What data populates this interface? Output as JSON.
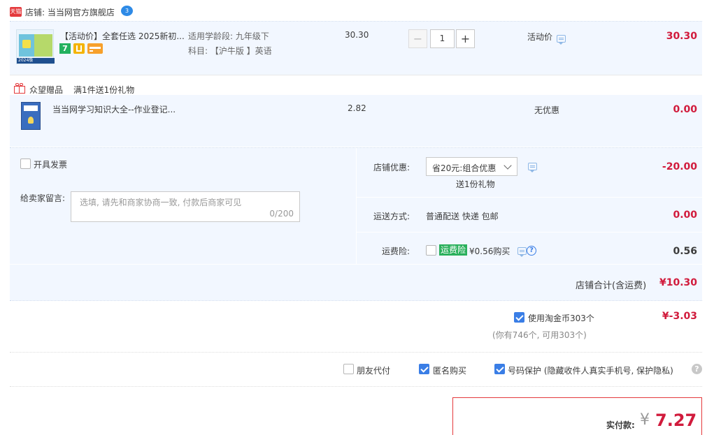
{
  "shop": {
    "badge": "天猫",
    "label": "店铺: 当当网官方旗舰店",
    "chat_badge": "3"
  },
  "item1": {
    "title": "【活动价】全套任选 2025新初...",
    "age": "适用学龄段: 九年级下",
    "subject": "科目: 【沪牛版 】英语",
    "thumb_caption": "2024版",
    "badge_seven": "7",
    "price": "30.30",
    "qty": "1",
    "minus": "−",
    "plus": "+",
    "promo": "活动价",
    "subtotal": "30.30"
  },
  "gift": {
    "label": "众望赠品",
    "rule": "满1件送1份礼物",
    "title": "当当网学习知识大全--作业登记...",
    "price": "2.82",
    "promo": "无优惠",
    "subtotal": "0.00"
  },
  "invoice": {
    "label": "开具发票"
  },
  "message": {
    "label": "给卖家留言:",
    "placeholder": "选填, 请先和商家协商一致, 付款后商家可见",
    "counter": "0/200"
  },
  "discount": {
    "label": "店铺优惠:",
    "select": "省20元:组合优惠",
    "sub": "送1份礼物",
    "amount": "-20.00"
  },
  "shipping": {
    "label": "运送方式:",
    "value": "普通配送 快递 包邮",
    "amount": "0.00"
  },
  "insurance": {
    "label": "运费险:",
    "tag": "运费险",
    "text": "¥0.56购买",
    "amount": "0.56"
  },
  "shop_total": {
    "label": "店铺合计(含运费)",
    "amount": "¥10.30"
  },
  "coins": {
    "label": "使用淘金币303个",
    "sub": "(你有746个, 可用303个)",
    "amount": "¥-3.03"
  },
  "options": {
    "friend": "朋友代付",
    "anon": "匿名购买",
    "phone": "号码保护 (隐藏收件人真实手机号, 保护隐私)"
  },
  "pay": {
    "label": "实付款:",
    "currency": "¥",
    "amount": "7.27"
  }
}
